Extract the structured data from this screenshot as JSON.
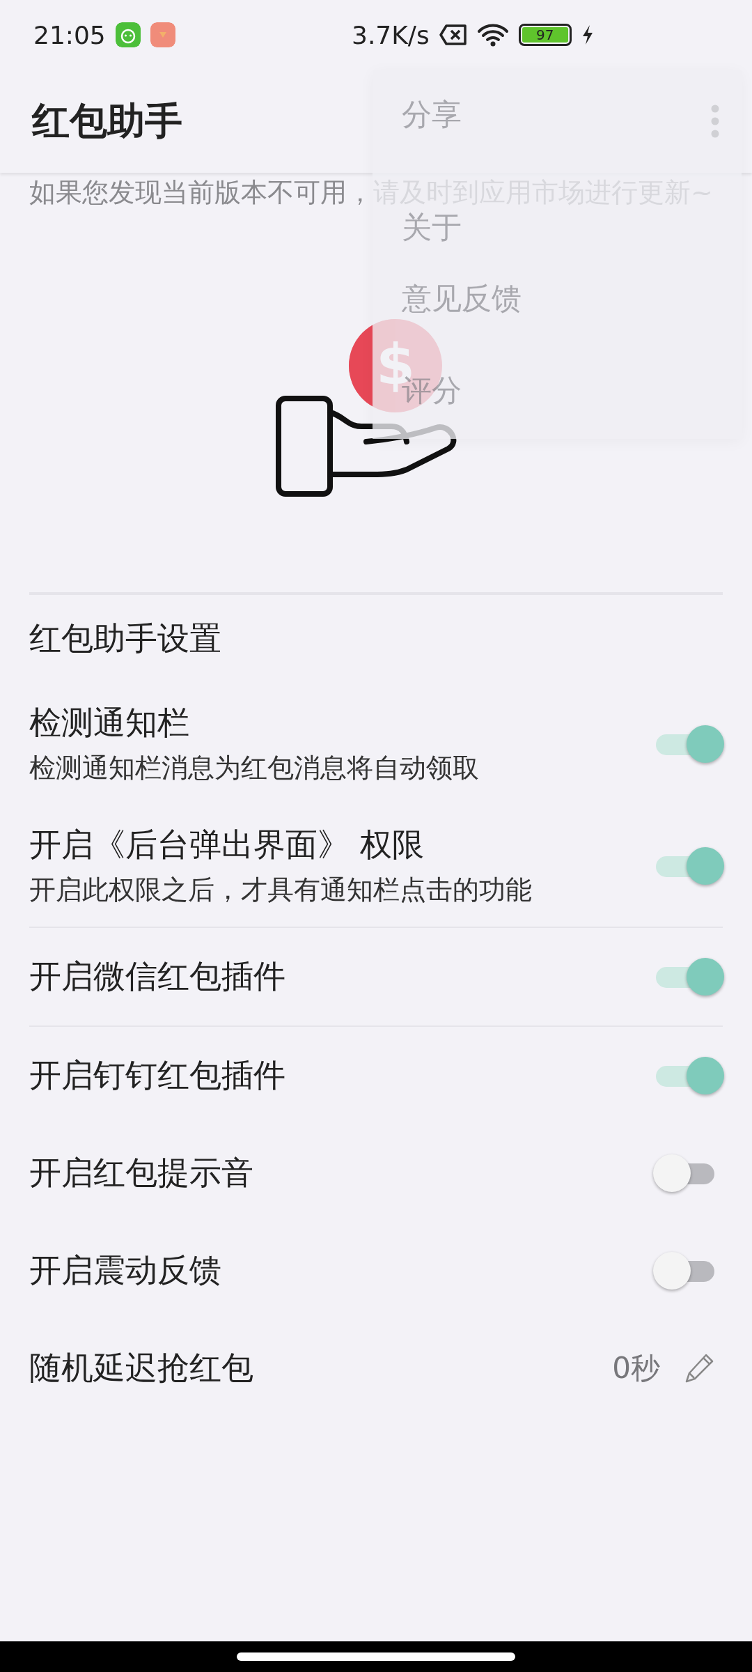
{
  "status_bar": {
    "time": "21:05",
    "net_speed": "3.7K/s",
    "battery": "97"
  },
  "app_bar": {
    "title": "红包助手"
  },
  "overflow_menu": {
    "items": [
      "分享",
      "关于",
      "意见反馈",
      "评分"
    ]
  },
  "coin_symbol": "$",
  "notice": "如果您发现当前版本不可用，请及时到应用市场进行更新~",
  "section_title": "红包助手设置",
  "groups": [
    {
      "items": [
        {
          "kind": "switch",
          "title": "检测通知栏",
          "subtitle": "检测通知栏消息为红包消息将自动领取",
          "on": true
        },
        {
          "kind": "switch",
          "title": "开启《后台弹出界面》 权限",
          "subtitle": "开启此权限之后，才具有通知栏点击的功能",
          "on": true
        }
      ]
    },
    {
      "items": [
        {
          "kind": "switch",
          "title": "开启微信红包插件",
          "on": true
        }
      ]
    },
    {
      "items": [
        {
          "kind": "switch",
          "title": "开启钉钉红包插件",
          "on": true
        },
        {
          "kind": "switch",
          "title": "开启红包提示音",
          "on": false
        },
        {
          "kind": "switch",
          "title": "开启震动反馈",
          "on": false
        },
        {
          "kind": "edit",
          "title": "随机延迟抢红包",
          "value": "0秒"
        }
      ]
    }
  ]
}
